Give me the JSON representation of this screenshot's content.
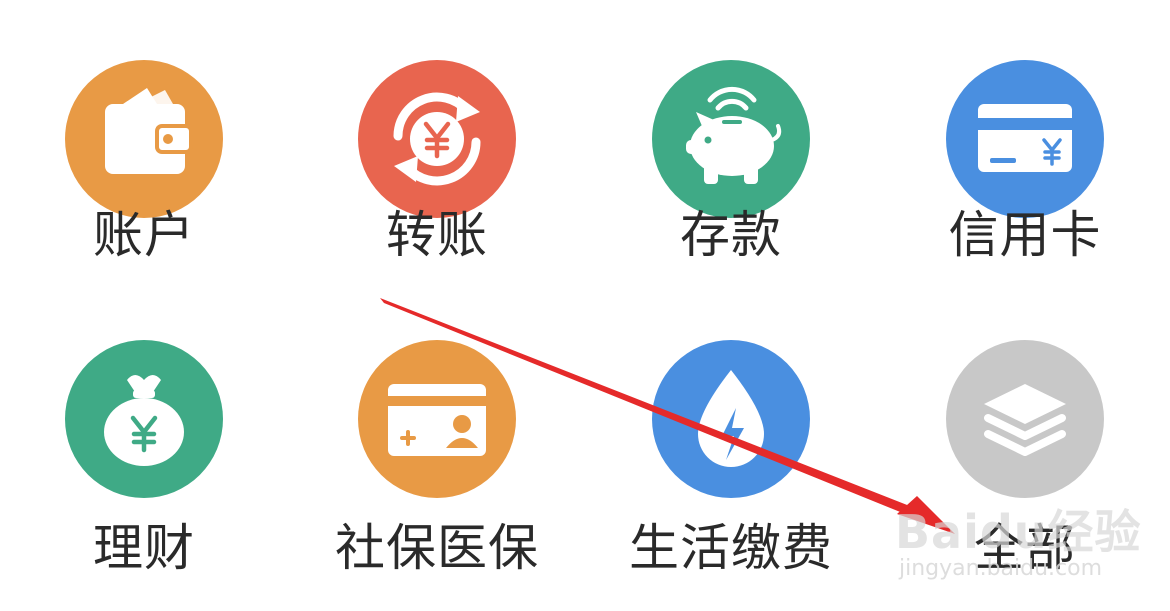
{
  "menu": {
    "items": [
      {
        "id": "account",
        "label": "账户",
        "icon": "wallet-icon",
        "color": "#E89A45"
      },
      {
        "id": "transfer",
        "label": "转账",
        "icon": "transfer-yuan-icon",
        "color": "#E8654F"
      },
      {
        "id": "deposit",
        "label": "存款",
        "icon": "piggy-bank-icon",
        "color": "#3FAA86"
      },
      {
        "id": "credit-card",
        "label": "信用卡",
        "icon": "credit-card-icon",
        "color": "#4A8FE0"
      },
      {
        "id": "wealth",
        "label": "理财",
        "icon": "money-bag-icon",
        "color": "#3FAA86"
      },
      {
        "id": "social-security",
        "label": "社保医保",
        "icon": "id-card-icon",
        "color": "#E89A45"
      },
      {
        "id": "utilities",
        "label": "生活缴费",
        "icon": "water-drop-bolt-icon",
        "color": "#4A8FE0"
      },
      {
        "id": "all",
        "label": "全部",
        "icon": "layers-icon",
        "color": "#C8C8C8"
      }
    ]
  },
  "annotation": {
    "arrow_color": "#E52A2A"
  },
  "watermark": {
    "logo": "Baidu经验",
    "url": "jingyan.baidu.com"
  }
}
